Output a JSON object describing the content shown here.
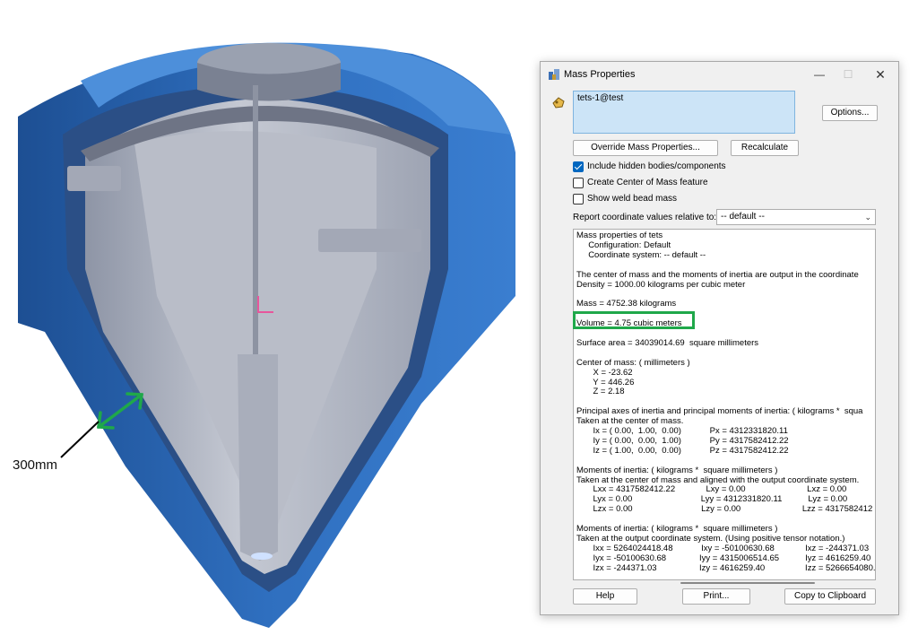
{
  "annotation": {
    "thickness_label": "300mm"
  },
  "dialog": {
    "title": "Mass Properties",
    "selection": "tets-1@test",
    "options_button": "Options...",
    "override_button": "Override Mass Properties...",
    "recalculate_button": "Recalculate",
    "checkboxes": [
      {
        "label": "Include hidden bodies/components",
        "checked": true
      },
      {
        "label": "Create Center of Mass feature",
        "checked": false
      },
      {
        "label": "Show weld bead mass",
        "checked": false
      }
    ],
    "report_label": "Report coordinate values relative to:",
    "report_value": "-- default --",
    "output_lines": [
      "Mass properties of tets",
      "     Configuration: Default",
      "     Coordinate system: -- default --",
      "",
      "The center of mass and the moments of inertia are output in the coordinate",
      "Density = 1000.00 kilograms per cubic meter",
      "",
      "Mass = 4752.38 kilograms",
      "",
      "Volume = 4.75 cubic meters",
      "",
      "Surface area = 34039014.69  square millimeters",
      "",
      "Center of mass: ( millimeters )",
      "       X = -23.62",
      "       Y = 446.26",
      "       Z = 2.18",
      "",
      "Principal axes of inertia and principal moments of inertia: ( kilograms *  squa",
      "Taken at the center of mass.",
      "       Ix = ( 0.00,  1.00,  0.00)            Px = 4312331820.11",
      "       Iy = ( 0.00,  0.00,  1.00)            Py = 4317582412.22",
      "       Iz = ( 1.00,  0.00,  0.00)            Pz = 4317582412.22",
      "",
      "Moments of inertia: ( kilograms *  square millimeters )",
      "Taken at the center of mass and aligned with the output coordinate system.",
      "       Lxx = 4317582412.22             Lxy = 0.00                          Lxz = 0.00",
      "       Lyx = 0.00                             Lyy = 4312331820.11           Lyz = 0.00",
      "       Lzx = 0.00                             Lzy = 0.00                          Lzz = 4317582412",
      "",
      "Moments of inertia: ( kilograms *  square millimeters )",
      "Taken at the output coordinate system. (Using positive tensor notation.)",
      "       Ixx = 5264024418.48            Ixy = -50100630.68             Ixz = -244371.03",
      "       Iyx = -50100630.68              Iyy = 4315006514.65           Iyz = 4616259.40",
      "       Izx = -244371.03                  Izy = 4616259.40                 Izz = 5266654080."
    ],
    "help_button": "Help",
    "print_button": "Print...",
    "copy_button": "Copy to Clipboard"
  }
}
